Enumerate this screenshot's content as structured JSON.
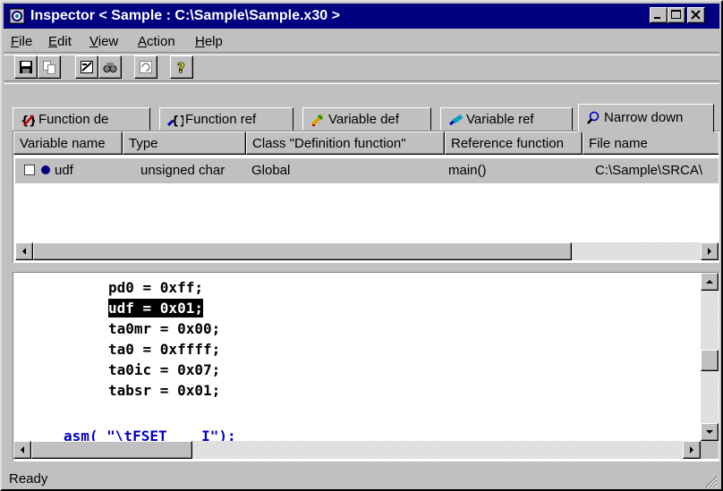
{
  "window": {
    "title": "Inspector < Sample : C:\\Sample\\Sample.x30 >",
    "controls": {
      "minimize": "minimize",
      "maximize": "maximize",
      "close": "close"
    }
  },
  "menu": {
    "items": [
      {
        "label": "File",
        "accel": "F"
      },
      {
        "label": "Edit",
        "accel": "E"
      },
      {
        "label": "View",
        "accel": "V"
      },
      {
        "label": "Action",
        "accel": "A"
      },
      {
        "label": "Help",
        "accel": "H"
      }
    ]
  },
  "toolbar": {
    "buttons": [
      "save-icon",
      "copy-icon",
      "properties-icon",
      "find-icon",
      "refresh-icon",
      "help-icon"
    ]
  },
  "tabs": [
    {
      "label": "Function de",
      "icon": "function-def-icon"
    },
    {
      "label": "Function ref",
      "icon": "function-ref-icon"
    },
    {
      "label": "Variable def",
      "icon": "variable-def-icon"
    },
    {
      "label": "Variable ref",
      "icon": "variable-ref-icon"
    },
    {
      "label": "Narrow down",
      "icon": "magnifier-icon",
      "active": true
    }
  ],
  "table": {
    "columns": [
      "Variable name",
      "Type",
      "Class \"Definition function\"",
      "Reference function",
      "File name"
    ],
    "rows": [
      {
        "name": "udf",
        "type": "unsigned char",
        "class": "Global",
        "ref_function": "main()",
        "file": "C:\\Sample\\SRCA\\"
      }
    ]
  },
  "code": {
    "lines": [
      "pd0 = 0xff;",
      "udf = 0x01;",
      "ta0mr = 0x00;",
      "ta0 = 0xffff;",
      "ta0ic = 0x07;",
      "tabsr = 0x01;"
    ],
    "partial_line": "asm( \"\\tFSET    I\");",
    "selected_index": 1
  },
  "status": {
    "text": "Ready"
  },
  "colors": {
    "titlebar": "#000080",
    "face": "#c0c0c0",
    "keyword_blue": "#0000c0"
  }
}
